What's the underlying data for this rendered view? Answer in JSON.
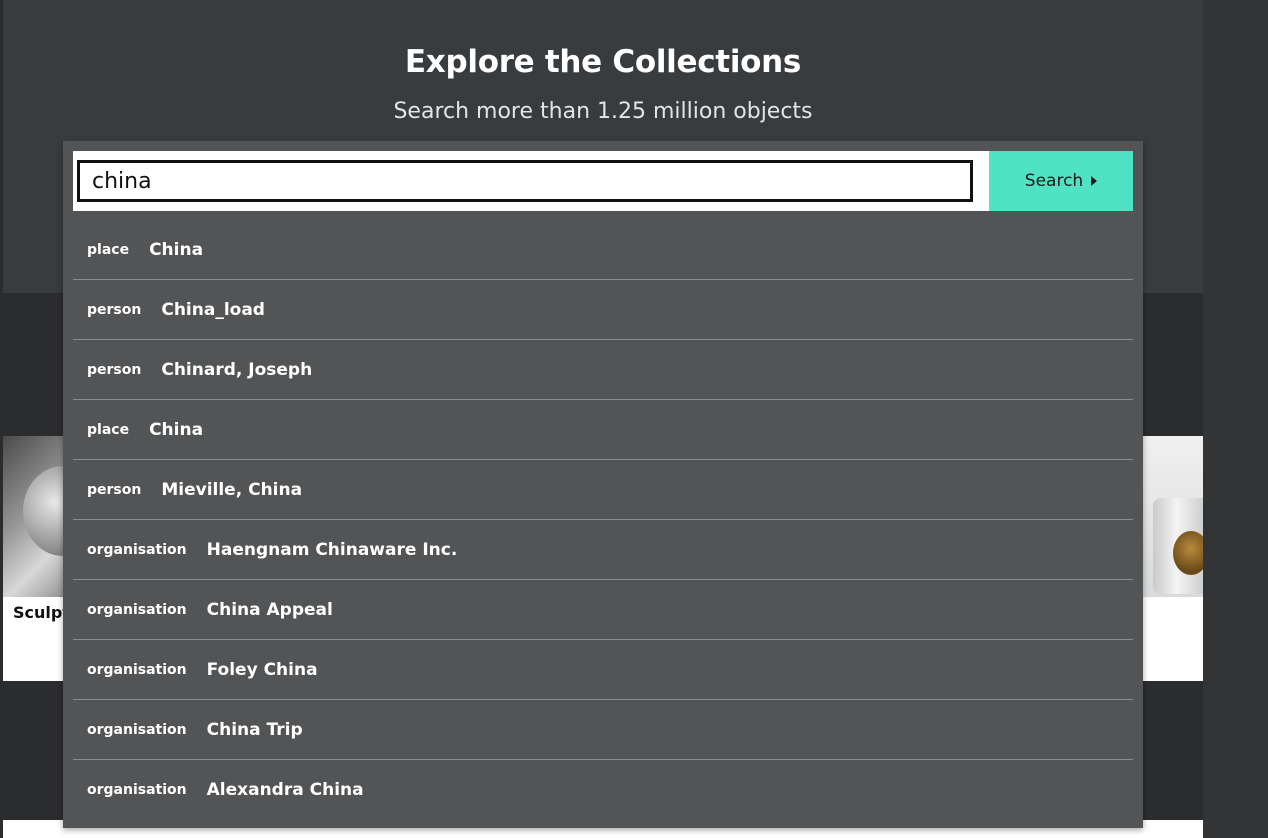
{
  "hero": {
    "title": "Explore the Collections",
    "subtitle": "Search more than 1.25 million objects"
  },
  "search": {
    "value": "china",
    "button_label": "Search",
    "button_icon": "caret-right-icon",
    "button_color": "#4fe3c3"
  },
  "suggestions": [
    {
      "type": "place",
      "name": "China"
    },
    {
      "type": "person",
      "name": "China_load"
    },
    {
      "type": "person",
      "name": "Chinard, Joseph"
    },
    {
      "type": "place",
      "name": "China"
    },
    {
      "type": "person",
      "name": "Mieville, China"
    },
    {
      "type": "organisation",
      "name": "Haengnam Chinaware Inc."
    },
    {
      "type": "organisation",
      "name": "China Appeal"
    },
    {
      "type": "organisation",
      "name": "Foley China"
    },
    {
      "type": "organisation",
      "name": "China Trip"
    },
    {
      "type": "organisation",
      "name": "Alexandra China"
    }
  ],
  "cards": {
    "left_caption": "Sculpt"
  }
}
